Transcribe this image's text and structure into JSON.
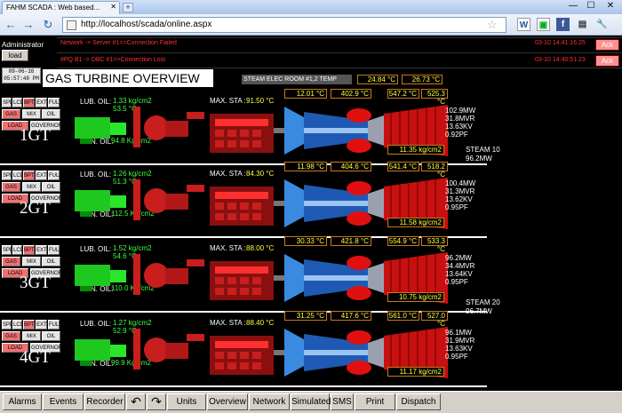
{
  "browser": {
    "tab_title": "FAHM SCADA : Web based...",
    "url": "http://localhost/scada/online.aspx",
    "win_min": "—",
    "win_max": "☐",
    "win_close": "✕",
    "back": "←",
    "forward": "→",
    "reload": "↻"
  },
  "header": {
    "user": "Administrator",
    "load_label": "load",
    "date": "09-06-16",
    "time": "05:57:48 PM",
    "page_title": "GAS TURBINE OVERVIEW",
    "steam_label": "STEAM ELEC ROOM #1,2 TEMP",
    "steam_temp1": "24.84 °C",
    "steam_temp2": "26.73 °C"
  },
  "alarms": [
    {
      "text": "Network -> Server #1=>Connection Failed",
      "time": "03-10 14:41:16.25",
      "ack": "Ack"
    },
    {
      "text": "#PQ B1 -> DBC #1=>Connection Lost",
      "time": "03-10 14:40:51.23",
      "ack": "Ack"
    }
  ],
  "mode_buttons": {
    "spd": "SPD",
    "lcd": "LCD",
    "bpt": "BPT",
    "ext": "EXT",
    "ful": "FUL",
    "gas": "GAS",
    "mix": "MIX",
    "oil": "OIL",
    "load": "LOAD",
    "governor": "GOVERNOR"
  },
  "labels": {
    "lub_oil": "LUB. OIL:",
    "con_oil": "CON. OIL:",
    "max_sta": "MAX. STA :"
  },
  "units": [
    {
      "name": "1GT",
      "lub_pressure": "1.33 kg/cm2",
      "lub_temp": "53.5 °C",
      "con_oil": "94.8 Kg/cm2",
      "max_sta": "91.50 °C",
      "temps": [
        "12.01 °C",
        "402.9 °C",
        "547.2 °C",
        "525.3 °C"
      ],
      "exhaust": "11.35 kg/cm2",
      "mw": "102.9MW",
      "mvr": "31.8MVR",
      "kv": "13.63KV",
      "pf": "0.92PF"
    },
    {
      "name": "2GT",
      "lub_pressure": "1.26 kg/cm2",
      "lub_temp": "51.3 °C",
      "con_oil": "112.5 Kg/cm2",
      "max_sta": "84.30 °C",
      "temps": [
        "11.98 °C",
        "404.6 °C",
        "541.4 °C",
        "518.2 °C"
      ],
      "exhaust": "11.58 kg/cm2",
      "mw": "100.4MW",
      "mvr": "31.3MVR",
      "kv": "13.62KV",
      "pf": "0.95PF"
    },
    {
      "name": "3GT",
      "lub_pressure": "1.52 kg/cm2",
      "lub_temp": "54.6 °C",
      "con_oil": "110.0 Kg/cm2",
      "max_sta": "88.00 °C",
      "temps": [
        "30.33 °C",
        "421.8 °C",
        "554.9 °C",
        "533.3 °C"
      ],
      "exhaust": "10.75 kg/cm2",
      "mw": "96.2MW",
      "mvr": "34.4MVR",
      "kv": "13.64KV",
      "pf": "0.95PF"
    },
    {
      "name": "4GT",
      "lub_pressure": "1.27 kg/cm2",
      "lub_temp": "52.9 °C",
      "con_oil": "99.9 Kg/cm2",
      "max_sta": "88.40 °C",
      "temps": [
        "31.25 °C",
        "417.6 °C",
        "561.0 °C",
        "527.0 °C"
      ],
      "exhaust": "11.17 kg/cm2",
      "mw": "96.1MW",
      "mvr": "31.9MVR",
      "kv": "13.63KV",
      "pf": "0.95PF"
    }
  ],
  "steam": [
    {
      "name": "STEAM 10",
      "mw": "96.2MW"
    },
    {
      "name": "STEAM 20",
      "mw": "96.7MW"
    }
  ],
  "bottom_buttons": {
    "alarms": "Alarms",
    "events": "Events",
    "recorder": "Recorder",
    "undo": "↶",
    "redo": "↷",
    "units": "Units",
    "overview": "Overview",
    "network": "Network",
    "simulated": "Simulated",
    "sms": "SMS",
    "print": "Print",
    "dispatch": "Dispatch"
  },
  "colors": {
    "value_yellow": "#ffff40",
    "value_green": "#40ff40",
    "alarm_red": "#ff3030",
    "ack_bg": "#ff9090"
  }
}
